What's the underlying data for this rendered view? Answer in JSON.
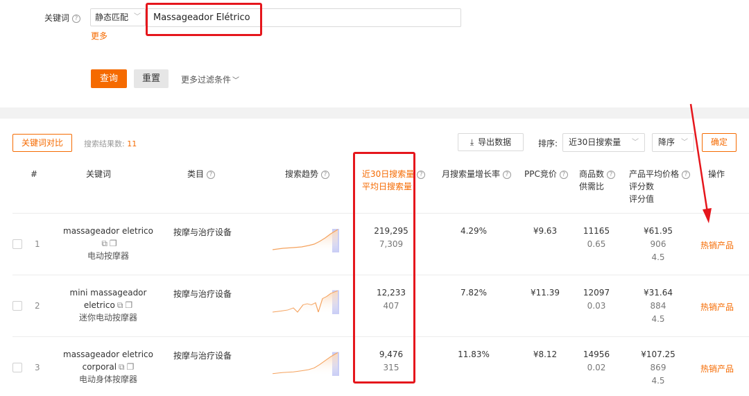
{
  "filter": {
    "keyword_label": "关键词",
    "match_mode": "静态匹配",
    "keyword_value": "Massageador Elétrico",
    "more_label": "更多",
    "query_label": "查询",
    "reset_label": "重置",
    "more_filters_label": "更多过滤条件"
  },
  "toolbar": {
    "compare_label": "关键词对比",
    "result_count_label": "搜索结果数:",
    "result_count": "11",
    "export_label": "导出数据",
    "sort_label": "排序:",
    "sort_value": "近30日搜索量",
    "order_value": "降序",
    "confirm_label": "确定"
  },
  "table": {
    "headers": {
      "index": "#",
      "keyword": "关键词",
      "category": "类目",
      "trend": "搜索趋势",
      "search_30d": "近30日搜索量",
      "search_avg": "平均日搜索量",
      "monthly_growth": "月搜索量增长率",
      "ppc": "PPC竞价",
      "product_count": "商品数",
      "supply_demand": "供需比",
      "avg_price": "产品平均价格",
      "rating_count": "评分数",
      "rating_value": "评分值",
      "action": "操作"
    },
    "rows": [
      {
        "index": "1",
        "keyword_line1": "massageador eletrico",
        "keyword_line2": "",
        "keyword_cn": "电动按摩器",
        "category": "按摩与治疗设备",
        "search_30d": "219,295",
        "search_avg": "7,309",
        "monthly_growth": "4.29%",
        "ppc": "¥9.63",
        "product_count": "11165",
        "supply_demand": "0.65",
        "avg_price": "¥61.95",
        "rating_count": "906",
        "rating_value": "4.5",
        "action": "热销产品"
      },
      {
        "index": "2",
        "keyword_line1": "mini massageador",
        "keyword_line2": "eletrico",
        "keyword_cn": "迷你电动按摩器",
        "category": "按摩与治疗设备",
        "search_30d": "12,233",
        "search_avg": "407",
        "monthly_growth": "7.82%",
        "ppc": "¥11.39",
        "product_count": "12097",
        "supply_demand": "0.03",
        "avg_price": "¥31.64",
        "rating_count": "884",
        "rating_value": "4.5",
        "action": "热销产品"
      },
      {
        "index": "3",
        "keyword_line1": "massageador eletrico",
        "keyword_line2": "corporal",
        "keyword_cn": "电动身体按摩器",
        "category": "按摩与治疗设备",
        "search_30d": "9,476",
        "search_avg": "315",
        "monthly_growth": "11.83%",
        "ppc": "¥8.12",
        "product_count": "14956",
        "supply_demand": "0.02",
        "avg_price": "¥107.25",
        "rating_count": "869",
        "rating_value": "4.5",
        "action": "热销产品"
      }
    ]
  },
  "colors": {
    "accent": "#f56a00",
    "annotation_red": "#e5161c",
    "spark_line": "#f5a25d",
    "spark_highlight": "#c9cdf5"
  }
}
